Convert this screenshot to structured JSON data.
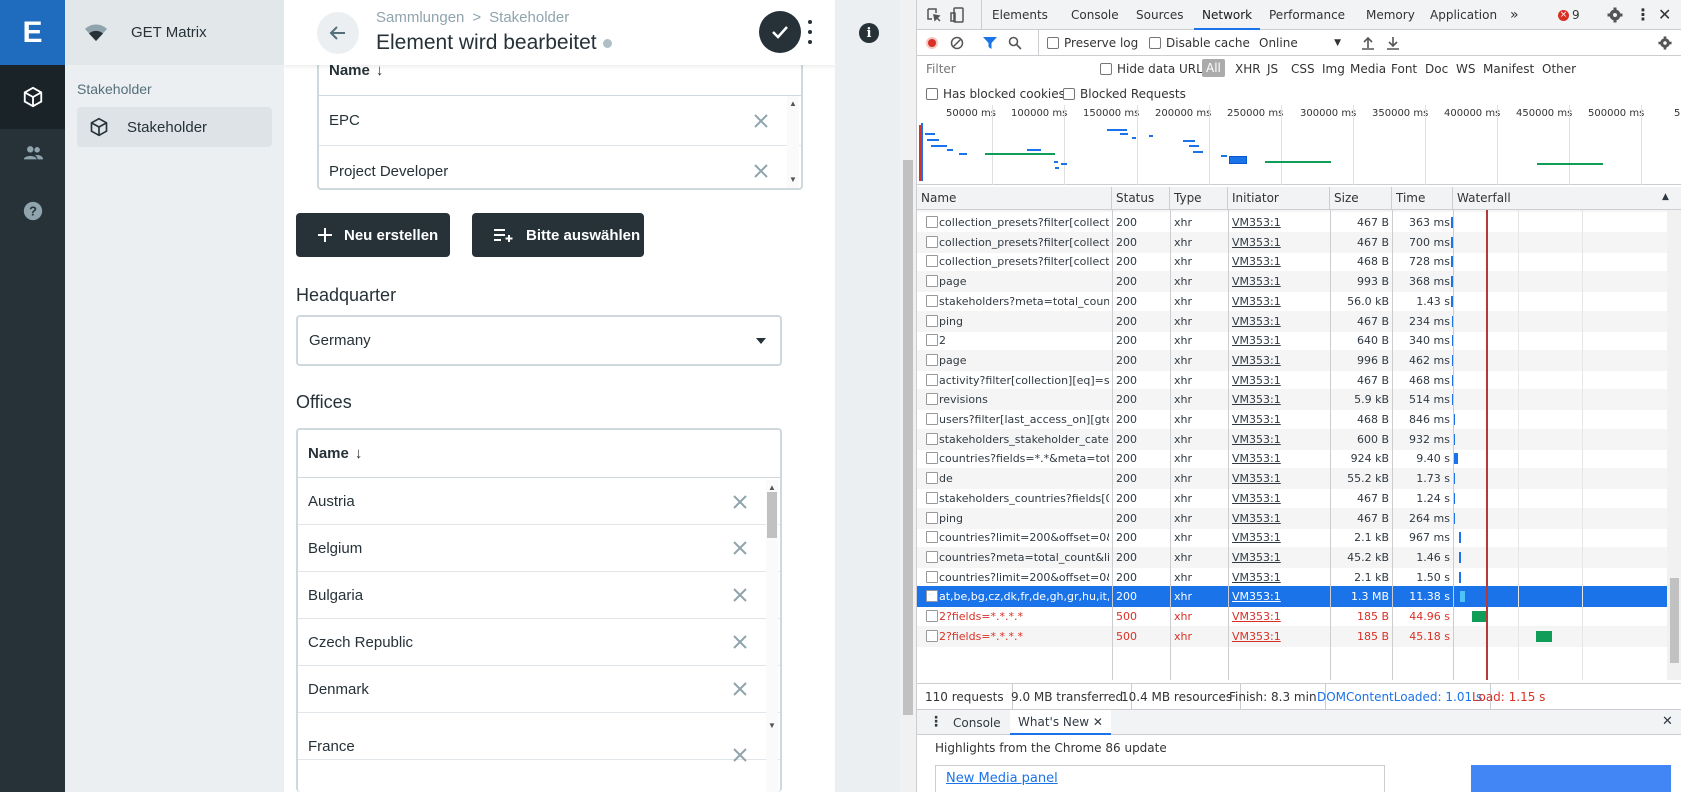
{
  "app": {
    "logo_letter": "E",
    "project_name": "GET Matrix",
    "nav_group": "Stakeholder",
    "nav_item": "Stakeholder",
    "breadcrumb": [
      "Sammlungen",
      "Stakeholder"
    ],
    "breadcrumb_sep": ">",
    "page_title": "Element wird bearbeitet",
    "stakeholder_categories": {
      "header": "Name",
      "sort_icon": "↓",
      "rows": [
        "EPC",
        "Project Developer"
      ]
    },
    "buttons": {
      "create": "Neu erstellen",
      "select": "Bitte auswählen"
    },
    "headquarter": {
      "label": "Headquarter",
      "value": "Germany"
    },
    "offices": {
      "label": "Offices",
      "header": "Name",
      "sort_icon": "↓",
      "rows": [
        "Austria",
        "Belgium",
        "Bulgaria",
        "Czech Republic",
        "Denmark",
        "France"
      ]
    },
    "colors": {
      "brand": "#1f6cbf",
      "dark": "#263238",
      "sidebar": "#eceff1"
    }
  },
  "devtools": {
    "tabs": [
      "Elements",
      "Console",
      "Sources",
      "Network",
      "Performance",
      "Memory",
      "Application"
    ],
    "active_tab": "Network",
    "overflow_tabs": "»",
    "error_count": "9",
    "toolbar": {
      "preserve_log": "Preserve log",
      "disable_cache": "Disable cache",
      "throttling": "Online"
    },
    "filter": {
      "placeholder": "Filter",
      "hide_data_urls": "Hide data URLs",
      "types": [
        "All",
        "XHR",
        "JS",
        "CSS",
        "Img",
        "Media",
        "Font",
        "Doc",
        "WS",
        "Manifest",
        "Other"
      ],
      "has_blocked_cookies": "Has blocked cookies",
      "blocked_requests": "Blocked Requests"
    },
    "overview_ticks": [
      "50000 ms",
      "100000 ms",
      "150000 ms",
      "200000 ms",
      "250000 ms",
      "300000 ms",
      "350000 ms",
      "400000 ms",
      "450000 ms",
      "500000 ms",
      "5"
    ],
    "columns": [
      "Name",
      "Status",
      "Type",
      "Initiator",
      "Size",
      "Time",
      "Waterfall"
    ],
    "requests": [
      {
        "name": "collection_presets?filter[collection...",
        "status": "200",
        "type": "xhr",
        "initiator": "VM353:1",
        "size": "467 B",
        "time": "363 ms"
      },
      {
        "name": "collection_presets?filter[collection...",
        "status": "200",
        "type": "xhr",
        "initiator": "VM353:1",
        "size": "467 B",
        "time": "700 ms"
      },
      {
        "name": "collection_presets?filter[collection...",
        "status": "200",
        "type": "xhr",
        "initiator": "VM353:1",
        "size": "468 B",
        "time": "728 ms"
      },
      {
        "name": "page",
        "status": "200",
        "type": "xhr",
        "initiator": "VM353:1",
        "size": "993 B",
        "time": "368 ms"
      },
      {
        "name": "stakeholders?meta=total_count...",
        "status": "200",
        "type": "xhr",
        "initiator": "VM353:1",
        "size": "56.0 kB",
        "time": "1.43 s"
      },
      {
        "name": "ping",
        "status": "200",
        "type": "xhr",
        "initiator": "VM353:1",
        "size": "467 B",
        "time": "234 ms"
      },
      {
        "name": "2",
        "status": "200",
        "type": "xhr",
        "initiator": "VM353:1",
        "size": "640 B",
        "time": "340 ms"
      },
      {
        "name": "page",
        "status": "200",
        "type": "xhr",
        "initiator": "VM353:1",
        "size": "996 B",
        "time": "462 ms"
      },
      {
        "name": "activity?filter[collection][eq]=sta...",
        "status": "200",
        "type": "xhr",
        "initiator": "VM353:1",
        "size": "467 B",
        "time": "468 ms"
      },
      {
        "name": "revisions",
        "status": "200",
        "type": "xhr",
        "initiator": "VM353:1",
        "size": "5.9 kB",
        "time": "514 ms"
      },
      {
        "name": "users?filter[last_access_on][gte]...",
        "status": "200",
        "type": "xhr",
        "initiator": "VM353:1",
        "size": "468 B",
        "time": "846 ms"
      },
      {
        "name": "stakeholders_stakeholder_categ...",
        "status": "200",
        "type": "xhr",
        "initiator": "VM353:1",
        "size": "600 B",
        "time": "932 ms"
      },
      {
        "name": "countries?fields=*.*&meta=total...",
        "status": "200",
        "type": "xhr",
        "initiator": "VM353:1",
        "size": "924 kB",
        "time": "9.40 s"
      },
      {
        "name": "de",
        "status": "200",
        "type": "xhr",
        "initiator": "VM353:1",
        "size": "55.2 kB",
        "time": "1.73 s"
      },
      {
        "name": "stakeholders_countries?fields[0]...",
        "status": "200",
        "type": "xhr",
        "initiator": "VM353:1",
        "size": "467 B",
        "time": "1.24 s"
      },
      {
        "name": "ping",
        "status": "200",
        "type": "xhr",
        "initiator": "VM353:1",
        "size": "467 B",
        "time": "264 ms"
      },
      {
        "name": "countries?limit=200&offset=0&...",
        "status": "200",
        "type": "xhr",
        "initiator": "VM353:1",
        "size": "2.1 kB",
        "time": "967 ms"
      },
      {
        "name": "countries?meta=total_count&li...",
        "status": "200",
        "type": "xhr",
        "initiator": "VM353:1",
        "size": "45.2 kB",
        "time": "1.46 s"
      },
      {
        "name": "countries?limit=200&offset=0&...",
        "status": "200",
        "type": "xhr",
        "initiator": "VM353:1",
        "size": "2.1 kB",
        "time": "1.50 s"
      },
      {
        "name": "at,be,bg,cz,dk,fr,de,gh,gr,hu,it,ke,...",
        "status": "200",
        "type": "xhr",
        "initiator": "VM353:1",
        "size": "1.3 MB",
        "time": "11.38 s",
        "selected": true
      },
      {
        "name": "2?fields=*.*.*.*",
        "status": "500",
        "type": "xhr",
        "initiator": "VM353:1",
        "size": "185 B",
        "time": "44.96 s",
        "error": true
      },
      {
        "name": "2?fields=*.*.*.*",
        "status": "500",
        "type": "xhr",
        "initiator": "VM353:1",
        "size": "185 B",
        "time": "45.18 s",
        "error": true
      }
    ],
    "status_bar": {
      "requests": "110 requests",
      "transferred": "9.0 MB transferred",
      "resources": "10.4 MB resources",
      "finish": "Finish: 8.3 min",
      "dom_content_loaded": "DOMContentLoaded: 1.01 s",
      "load": "Load: 1.15 s"
    },
    "drawer": {
      "tabs": [
        "Console",
        "What's New"
      ],
      "headline": "Highlights from the Chrome 86 update",
      "card_title": "New Media panel"
    },
    "colors": {
      "accent": "#1a73e8",
      "error": "#d93025",
      "domcl": "#1a73e8",
      "load": "#d93025"
    }
  }
}
